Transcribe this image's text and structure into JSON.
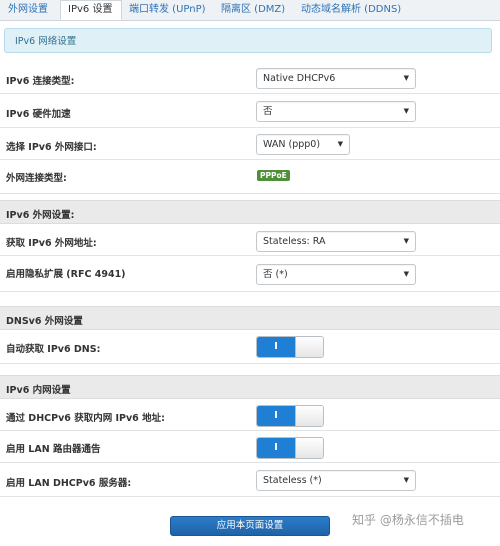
{
  "tabs": [
    {
      "label": "外网设置"
    },
    {
      "label": "IPv6 设置"
    },
    {
      "label": "端口转发 (UPnP)"
    },
    {
      "label": "隔离区 (DMZ)"
    },
    {
      "label": "动态域名解析 (DDNS)"
    }
  ],
  "banner": {
    "text": "IPv6 网络设置"
  },
  "fields": {
    "conn_type": {
      "label": "IPv6 连接类型:",
      "value": "Native DHCPv6"
    },
    "hw_accel": {
      "label": "IPv6 硬件加速",
      "value": "否"
    },
    "wan_iface": {
      "label": "选择 IPv6 外网接口:",
      "value": "WAN (ppp0)"
    },
    "ext_conn_type": {
      "label": "外网连接类型:",
      "badge": "PPPoE"
    },
    "get_addr": {
      "label": "获取 IPv6 外网地址:",
      "value": "Stateless: RA"
    },
    "privacy_ext": {
      "label": "启用隐私扩展 (RFC 4941)",
      "value": "否 (*)"
    },
    "auto_dns": {
      "label": "自动获取 IPv6 DNS:",
      "toggle": "I"
    },
    "dhcpv6_lan": {
      "label": "通过 DHCPv6 获取内网 IPv6 地址:",
      "toggle": "I"
    },
    "lan_router_adv": {
      "label": "启用 LAN 路由器通告",
      "toggle": "I"
    },
    "lan_dhcpv6_server": {
      "label": "启用 LAN DHCPv6 服务器:",
      "value": "Stateless (*)"
    }
  },
  "sections": {
    "wan": "IPv6 外网设置:",
    "dns": "DNSv6 外网设置",
    "lan": "IPv6 内网设置"
  },
  "caret": "▼",
  "apply_button": "应用本页面设置",
  "watermark": "知乎 @杨永信不插电",
  "colors": {
    "accent": "#1e7fd4",
    "badge": "#4f8f3a",
    "banner_bg": "#dff0f7",
    "section_bg": "#eaeaea"
  }
}
